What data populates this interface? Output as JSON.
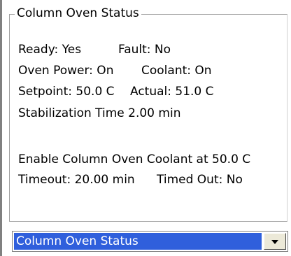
{
  "group": {
    "title": "Column Oven Status"
  },
  "status": {
    "ready": "Ready: Yes",
    "fault": "Fault: No",
    "oven_power": "Oven Power: On",
    "coolant": "Coolant: On",
    "setpoint": "Setpoint: 50.0 C",
    "actual": "Actual: 51.0 C",
    "stabilization": "Stabilization Time 2.00 min",
    "enable_coolant": "Enable Column Oven Coolant at 50.0 C",
    "timeout": "Timeout: 20.00 min",
    "timed_out": "Timed Out: No"
  },
  "dropdown": {
    "selected": "Column Oven Status",
    "button_icon": "chevron-down-icon"
  }
}
